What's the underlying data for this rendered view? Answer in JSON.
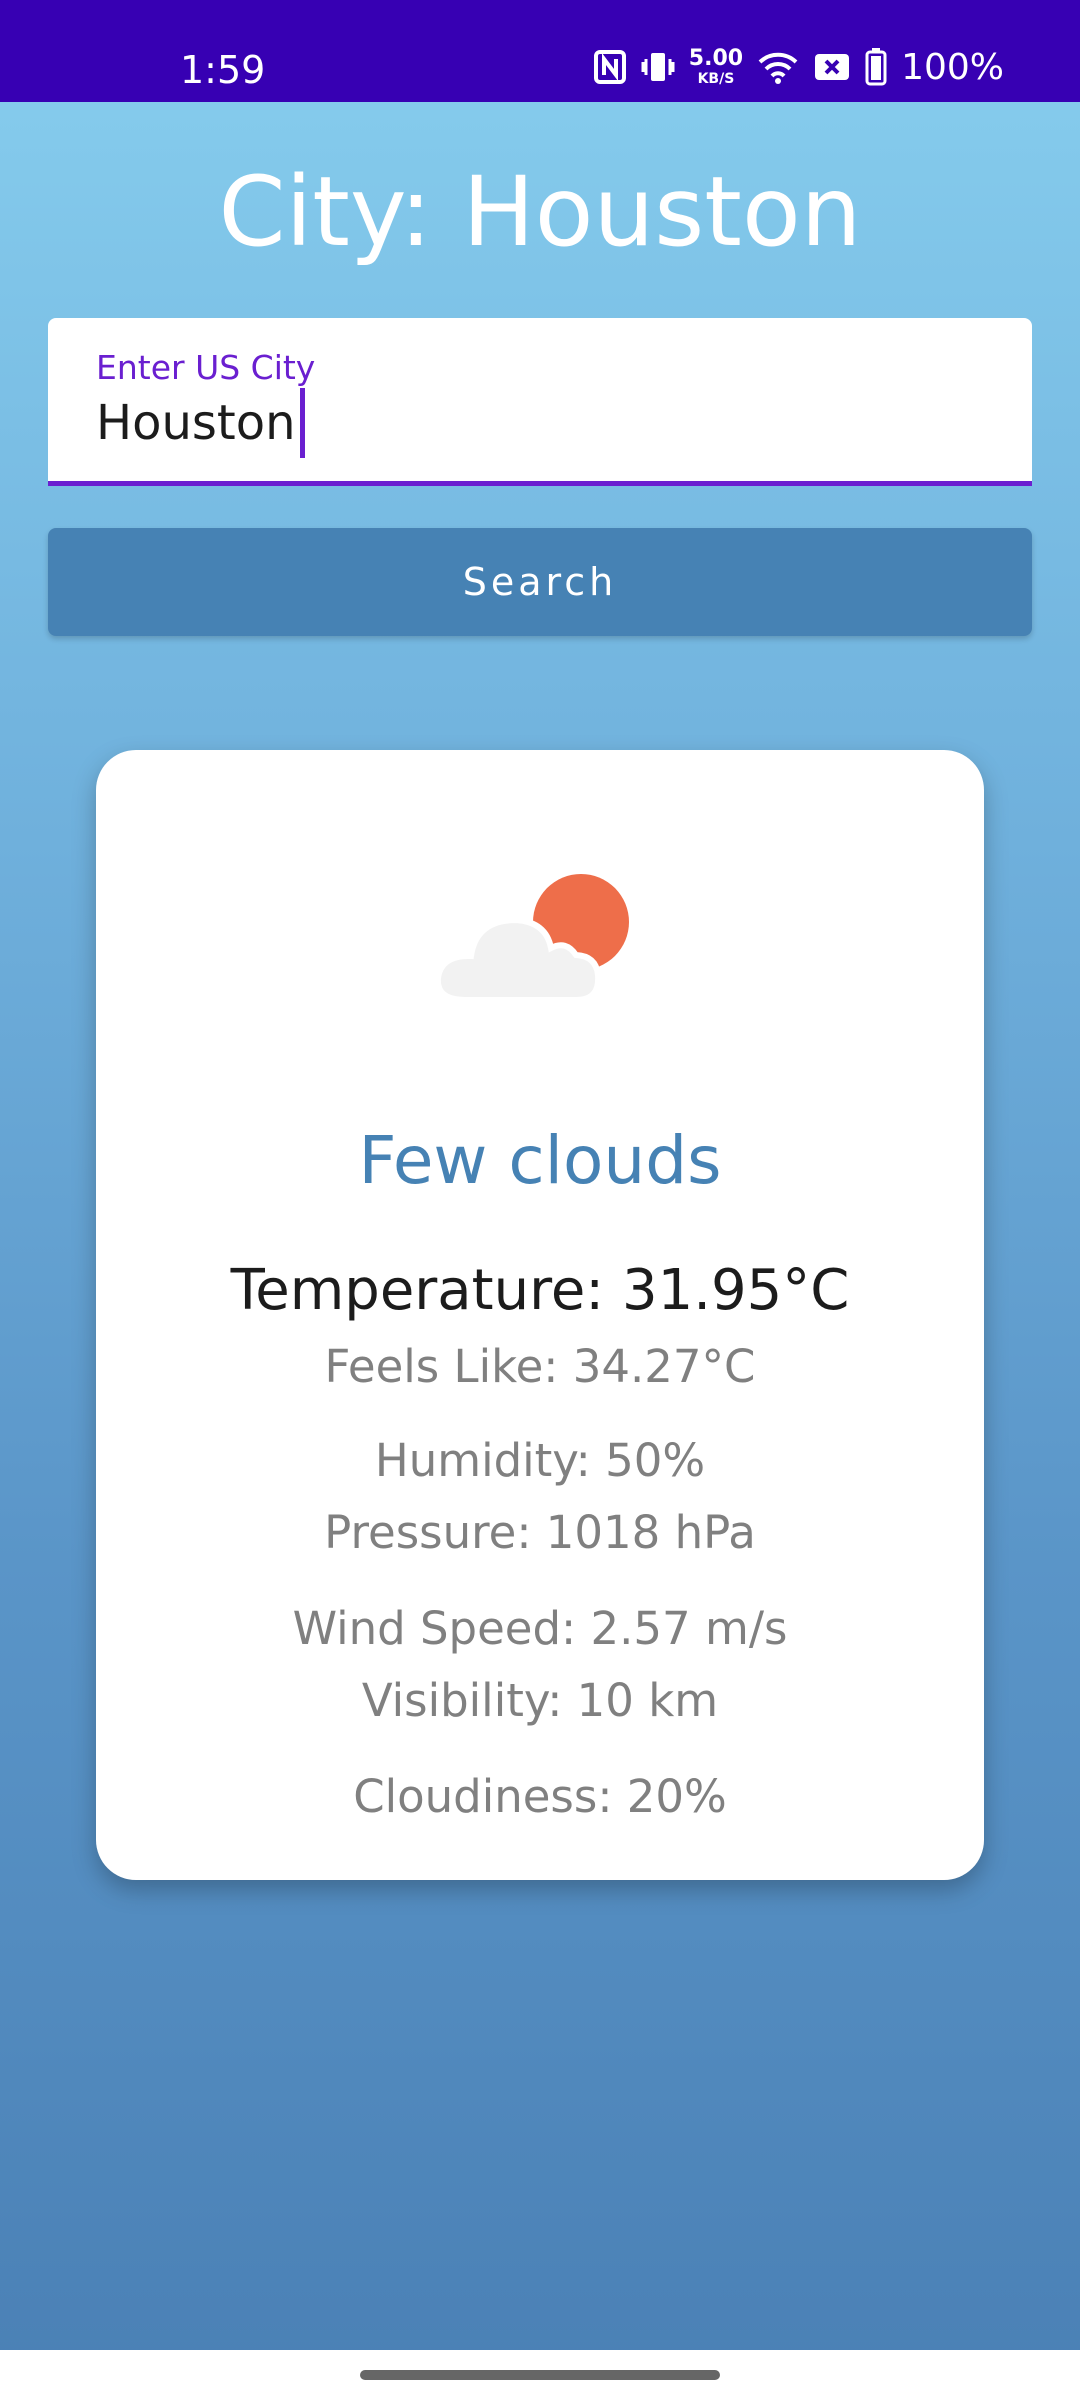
{
  "status_bar": {
    "time": "1:59",
    "net_speed_value": "5.00",
    "net_speed_unit": "KB/S",
    "battery": "100%"
  },
  "header": {
    "title": "City: Houston"
  },
  "search": {
    "label": "Enter US City",
    "value": "Houston",
    "button_label": "Search"
  },
  "weather": {
    "icon": "few-clouds-day-icon",
    "condition": "Few clouds",
    "temperature": "Temperature: 31.95°C",
    "feels_like": "Feels Like: 34.27°C",
    "humidity": "Humidity: 50%",
    "pressure": "Pressure: 1018 hPa",
    "wind_speed": "Wind Speed: 2.57 m/s",
    "visibility": "Visibility: 10 km",
    "cloudiness": "Cloudiness: 20%"
  },
  "colors": {
    "status_bar": "#3700b3",
    "accent": "#6a1fd0",
    "button": "#4682b4",
    "sun": "#ee6e4a",
    "cloud": "#f2f2f2"
  }
}
